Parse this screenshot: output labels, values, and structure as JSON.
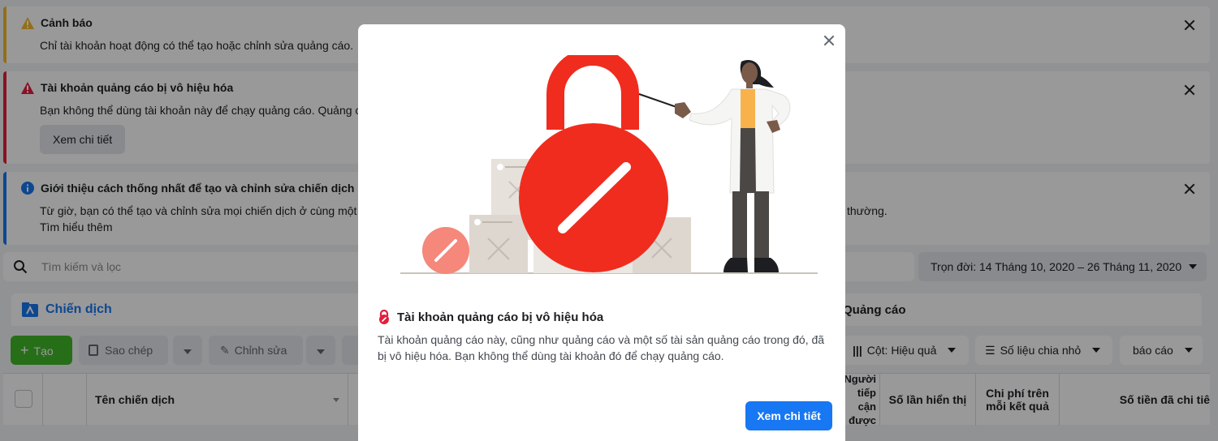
{
  "banners": {
    "warning": {
      "title": "Cảnh báo",
      "message": "Chỉ tài khoản hoạt động có thể tạo hoặc chỉnh sửa quảng cáo."
    },
    "error": {
      "title": "Tài khoản quảng cáo bị vô hiệu hóa",
      "message": "Bạn không thể dùng tài khoản này để chạy quảng cáo. Quảng cá",
      "button": "Xem chi tiết"
    },
    "info": {
      "title": "Giới thiệu cách thống nhất để tạo và chỉnh sửa chiến dịch",
      "message": "Từ giờ, bạn có thể tạo và chỉnh sửa mọi chiến dịch ở cùng một n",
      "message_tail": "thường.",
      "link": "Tìm hiểu thêm"
    }
  },
  "search": {
    "placeholder": "Tìm kiếm và lọc"
  },
  "date_range": "Trọn đời: 14 Tháng 10, 2020 – 26 Tháng 11, 2020",
  "tabs": {
    "campaigns": "Chiến dịch",
    "ads": "Quảng cáo"
  },
  "toolbar": {
    "create": "Tạo",
    "duplicate": "Sao chép",
    "edit": "Chỉnh sửa",
    "columns": "Cột: Hiệu quả",
    "breakdown": "Số liệu chia nhỏ",
    "reports": "báo cáo"
  },
  "table": {
    "columns": {
      "campaign_name": "Tên chiến dịch",
      "reach": "Người tiếp cận được",
      "impressions": "Số lần hiển thị",
      "cost_per_result": "Chi phí trên mỗi kết quả",
      "amount_spent": "Số tiền đã chi tiê"
    }
  },
  "modal": {
    "title": "Tài khoản quảng cáo bị vô hiệu hóa",
    "body": "Tài khoản quảng cáo này, cũng như quảng cáo và một số tài sản quảng cáo trong đó, đã bị vô hiệu hóa. Bạn không thể dùng tài khoản đó để chạy quảng cáo.",
    "button": "Xem chi tiết"
  },
  "colors": {
    "brand": "#1877f2",
    "error": "#e41e3f",
    "warning": "#f7b928",
    "lock_red": "#f02c1e",
    "create_green": "#42b72a"
  }
}
